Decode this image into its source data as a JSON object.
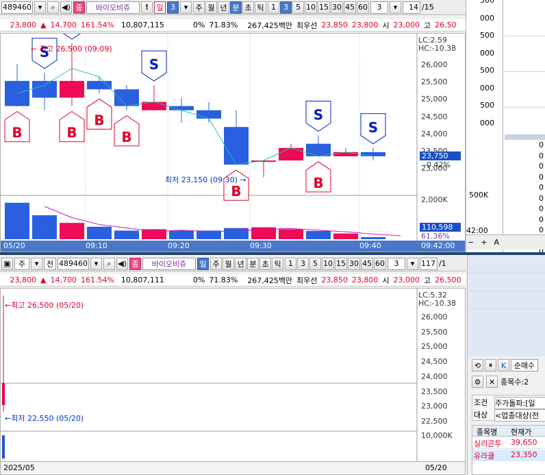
{
  "top": {
    "code": "489460",
    "stock_badge": "종",
    "stock_name": "바이오비쥬",
    "excl": "!",
    "period": "일",
    "period_n": "3",
    "tabs": [
      "주",
      "월",
      "년",
      "분",
      "초",
      "틱"
    ],
    "nums": [
      "1",
      "3",
      "5",
      "10",
      "15",
      "30",
      "45",
      "60"
    ],
    "sel_n": "3",
    "page": "14",
    "page_total": "/15"
  },
  "top_info": {
    "price": "23,800",
    "arrow": "▲",
    "change": "14,700",
    "pct": "161.54%",
    "volume": "10,807,115",
    "zero": "0%",
    "ratio": "71.83%",
    "amount": "267,425백만",
    "label_best": "최우선",
    "ask": "23,850",
    "bid": "23,800",
    "open_label": "시",
    "open": "23,000",
    "high_label": "고",
    "high": "26,50"
  },
  "top_chart": {
    "lc": "LC:2.59",
    "hc": "HC:-10.38",
    "y_ticks": [
      "26,000",
      "25,500",
      "25,000",
      "24,500",
      "24,000",
      "23,500",
      "23,000"
    ],
    "price_box": "23,750",
    "price_pct": "-0.42%",
    "vol_tick": "2,000K",
    "vol_box": "110,598",
    "vol_pct": "61.36%",
    "high_note": "최고 26,500 (09:09)",
    "low_note": "최저 23,150 (09:30)",
    "times": [
      "05/20",
      "09:10",
      "09:20",
      "09:30",
      "09:40",
      "09:42:00"
    ],
    "chart_data": {
      "type": "candlestick",
      "x": [
        "09:03",
        "09:06",
        "09:09",
        "09:12",
        "09:15",
        "09:18",
        "09:21",
        "09:24",
        "09:27",
        "09:30",
        "09:33",
        "09:36",
        "09:39",
        "09:42"
      ],
      "ohlc": [
        [
          25600,
          26000,
          25000,
          25000
        ],
        [
          25600,
          25800,
          24900,
          25200
        ],
        [
          25200,
          26500,
          25000,
          25600
        ],
        [
          25600,
          25700,
          25300,
          25400
        ],
        [
          25400,
          25500,
          24900,
          25000
        ],
        [
          24900,
          25500,
          24900,
          25100
        ],
        [
          25000,
          25200,
          24600,
          24900
        ],
        [
          24900,
          25100,
          24600,
          24700
        ],
        [
          24500,
          24900,
          23600,
          23600
        ],
        [
          23700,
          23700,
          23300,
          23700
        ],
        [
          23700,
          24100,
          23700,
          24000
        ],
        [
          24100,
          24300,
          23800,
          23800
        ],
        [
          23800,
          24000,
          23800,
          23900
        ],
        [
          23900,
          24000,
          23700,
          23800
        ]
      ],
      "volume": [
        1900,
        1250,
        850,
        650,
        450,
        520,
        450,
        450,
        580,
        620,
        520,
        430,
        300,
        110
      ],
      "signals": [
        {
          "i": 0,
          "t": "B"
        },
        {
          "i": 1,
          "t": "S"
        },
        {
          "i": 2,
          "t": "S"
        },
        {
          "i": 2,
          "t": "B"
        },
        {
          "i": 3,
          "t": "B"
        },
        {
          "i": 4,
          "t": "B"
        },
        {
          "i": 5,
          "t": "S"
        },
        {
          "i": 8,
          "t": "B"
        },
        {
          "i": 11,
          "t": "S"
        },
        {
          "i": 11,
          "t": "B"
        },
        {
          "i": 13,
          "t": "S"
        }
      ],
      "ylim": [
        22900,
        26600
      ]
    }
  },
  "bottom": {
    "code": "489460",
    "tab_a": "주",
    "tab_b": "전",
    "stock_badge": "종",
    "stock_name": "바이오비쥬",
    "period": "일",
    "tabs": [
      "주",
      "월",
      "년",
      "분",
      "초",
      "틱"
    ],
    "nums": [
      "1",
      "3",
      "5",
      "10",
      "15",
      "30",
      "45",
      "60"
    ],
    "sel_n": "3",
    "count": "117",
    "total": "/1"
  },
  "bottom_info": {
    "price": "23,800",
    "arrow": "▲",
    "change": "14,700",
    "pct": "161.54%",
    "volume": "10,807,111",
    "zero": "0%",
    "ratio": "71.83%",
    "amount": "267,425백만",
    "label_best": "최우선",
    "ask": "23,850",
    "bid": "23,800",
    "open_label": "시",
    "open": "23,000",
    "high_label": "고",
    "high": "26,500"
  },
  "bottom_chart": {
    "lc": "LC:5.32",
    "hc": "HC:-10.38",
    "y_ticks": [
      "26,000",
      "25,500",
      "25,000",
      "24,500",
      "24,000",
      "23,500",
      "23,000",
      "22,500"
    ],
    "vol_tick": "10,000K",
    "high_note": "최고 26,500 (05/20)",
    "low_note": "최저 22,550 (05/20)",
    "date_left": "2025/05",
    "date_right": "05/20"
  },
  "right_top": {
    "ticks": [
      "500",
      "000",
      "500",
      "000",
      "500",
      "000",
      "500",
      "000"
    ],
    "vol": "500K",
    "time": "42:00",
    "zeros": [
      "0",
      "0",
      "0",
      "0",
      "0",
      "0",
      "0",
      "0",
      "0",
      "0",
      "0"
    ],
    "ctrls": [
      "−",
      "+",
      "A"
    ]
  },
  "right_bottom": {
    "btns": [
      "⟲",
      "⏸",
      "K"
    ],
    "title": "순매수",
    "count_label": "종목수:2",
    "cond_label": "조건",
    "cond_value": "주가돌파:[일",
    "target_label": "대상",
    "target_value": "<업종대상(전",
    "headers": [
      "종목명",
      "현재가"
    ],
    "rows": [
      {
        "name": "실리콘투",
        "price": "39,650"
      },
      {
        "name": "유라클",
        "price": "23,350"
      }
    ]
  }
}
